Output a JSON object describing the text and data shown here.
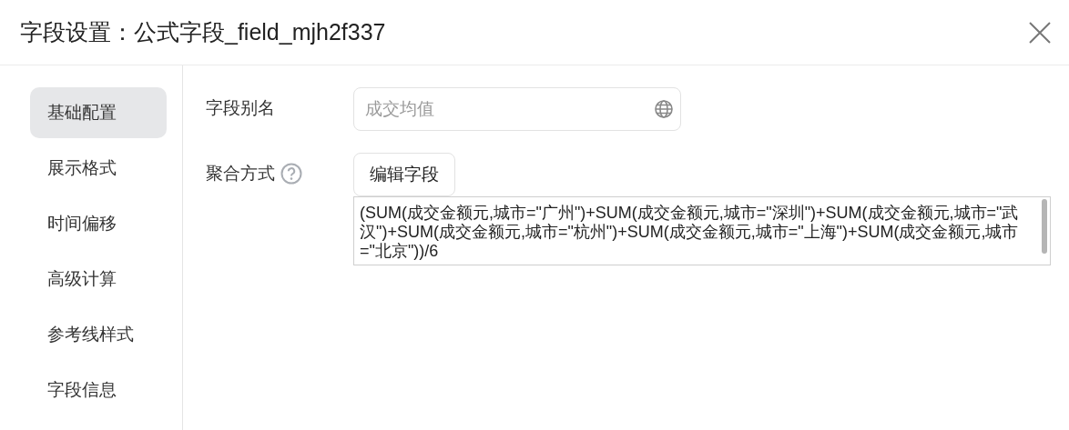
{
  "dialog": {
    "title": "字段设置：公式字段_field_mjh2f337"
  },
  "sidebar": {
    "items": [
      {
        "label": "基础配置",
        "selected": true
      },
      {
        "label": "展示格式",
        "selected": false
      },
      {
        "label": "时间偏移",
        "selected": false
      },
      {
        "label": "高级计算",
        "selected": false
      },
      {
        "label": "参考线样式",
        "selected": false
      },
      {
        "label": "字段信息",
        "selected": false
      }
    ]
  },
  "form": {
    "alias_label": "字段别名",
    "alias": {
      "placeholder": "成交均值"
    },
    "aggregation_label": "聚合方式",
    "edit_button": "编辑字段",
    "formula": "(SUM(成交金额元,城市=\"广州\")+SUM(成交金额元,城市=\"深圳\")+SUM(成交金额元,城市=\"武汉\")+SUM(成交金额元,城市=\"杭州\")+SUM(成交金额元,城市=\"上海\")+SUM(成交金额元,城市=\"北京\"))/6"
  }
}
